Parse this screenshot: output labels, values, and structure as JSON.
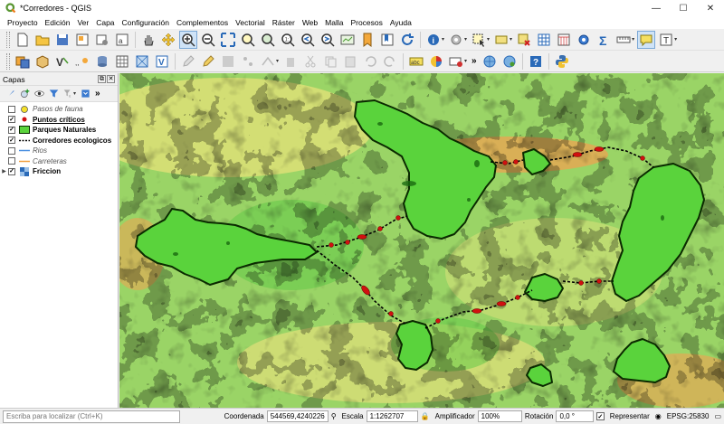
{
  "window": {
    "title": "*Corredores - QGIS",
    "minimize": "—",
    "maximize": "☐",
    "close": "✕"
  },
  "menu": [
    "Proyecto",
    "Edición",
    "Ver",
    "Capa",
    "Configuración",
    "Complementos",
    "Vectorial",
    "Ráster",
    "Web",
    "Malla",
    "Procesos",
    "Ayuda"
  ],
  "toolbar": {
    "label_tool_text": "abc",
    "textbox_tool": "T"
  },
  "layers_panel": {
    "title": "Capas",
    "float_btn": "⧉",
    "close_btn": "✕",
    "more": "»",
    "layers": [
      {
        "name": "Pasos de fauna",
        "checked": false,
        "style": "italic",
        "symbol": "yellow-circle"
      },
      {
        "name": "Puntos críticos",
        "checked": true,
        "style": "underline",
        "symbol": "red-point"
      },
      {
        "name": "Parques Naturales",
        "checked": true,
        "style": "bold",
        "symbol": "green-polygon"
      },
      {
        "name": "Corredores ecologicos",
        "checked": true,
        "style": "bold",
        "symbol": "dashed-line"
      },
      {
        "name": "Rios",
        "checked": false,
        "style": "italic",
        "symbol": "blue-line"
      },
      {
        "name": "Carreteras",
        "checked": false,
        "style": "italic",
        "symbol": "orange-line"
      },
      {
        "name": "Friccion",
        "checked": true,
        "style": "bold",
        "symbol": "raster",
        "expandable": true
      }
    ]
  },
  "statusbar": {
    "locator_placeholder": "Escriba para localizar (Ctrl+K)",
    "coordinate_label": "Coordenada",
    "coordinate_value": "544569,4240226",
    "scale_label": "Escala",
    "scale_value": "1:1262707",
    "magnifier_label": "Amplificador",
    "magnifier_value": "100%",
    "rotation_label": "Rotación",
    "rotation_value": "0,0 °",
    "render_label": "Representar",
    "crs": "EPSG:25830"
  },
  "colors": {
    "park_fill": "#5ad33c",
    "park_stroke": "#0a2a00",
    "critical_point": "#d01010",
    "corridor": "#000000",
    "friction_low": "#3cc43c",
    "friction_mid": "#e8e070",
    "friction_high": "#f07040"
  }
}
